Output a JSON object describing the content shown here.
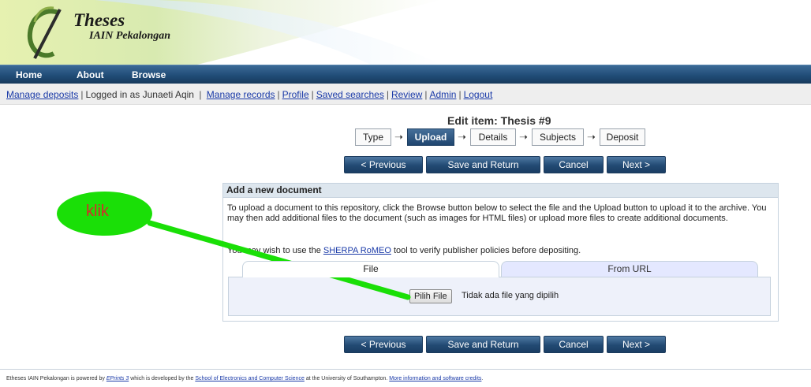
{
  "site": {
    "logo_title": "Theses",
    "logo_sub": "IAIN Pekalongan"
  },
  "nav": [
    "Home",
    "About",
    "Browse"
  ],
  "userbar": {
    "manage_deposits": "Manage deposits",
    "logged_in": "Logged in as Junaeti Aqin",
    "links": [
      "Manage records",
      "Profile",
      "Saved searches",
      "Review",
      "Admin",
      "Logout"
    ]
  },
  "page": {
    "title": "Edit item: Thesis #9"
  },
  "workflow": {
    "steps": [
      "Type",
      "Upload",
      "Details",
      "Subjects",
      "Deposit"
    ],
    "active": "Upload"
  },
  "buttons": {
    "previous": "< Previous",
    "save": "Save and Return",
    "cancel": "Cancel",
    "next": "Next >"
  },
  "panel": {
    "title": "Add a new document",
    "intro": "To upload a document to this repository, click the Browse button below to select the file and the Upload button to upload it to the archive. You may then add additional files to the document (such as images for HTML files) or upload more files to create additional documents.",
    "sherpa_prefix": "You may wish to use the",
    "sherpa_link": "SHERPA RoMEO",
    "sherpa_suffix": "tool to verify publisher policies before depositing.",
    "tabs": [
      "File",
      "From URL"
    ],
    "file_button": "Pilih File",
    "file_status": "Tidak ada file yang dipilih"
  },
  "annotation": {
    "text": "klik",
    "fill": "#1adf07",
    "text_color": "#d42b2b"
  },
  "footer": {
    "p1": "Etheses IAIN Pekalongan is powered by",
    "eprints": "EPrints 3",
    "p2": "which is developed by the",
    "school": "School of Electronics and Computer Science",
    "p3": "at the University of Southampton.",
    "more": "More information and software credits",
    "end": "."
  },
  "colors": {
    "nav_bg": "#214d78",
    "link": "#1a3aa8",
    "panel_head": "#dde6ee",
    "tab_url_bg": "#e4e8ff"
  }
}
